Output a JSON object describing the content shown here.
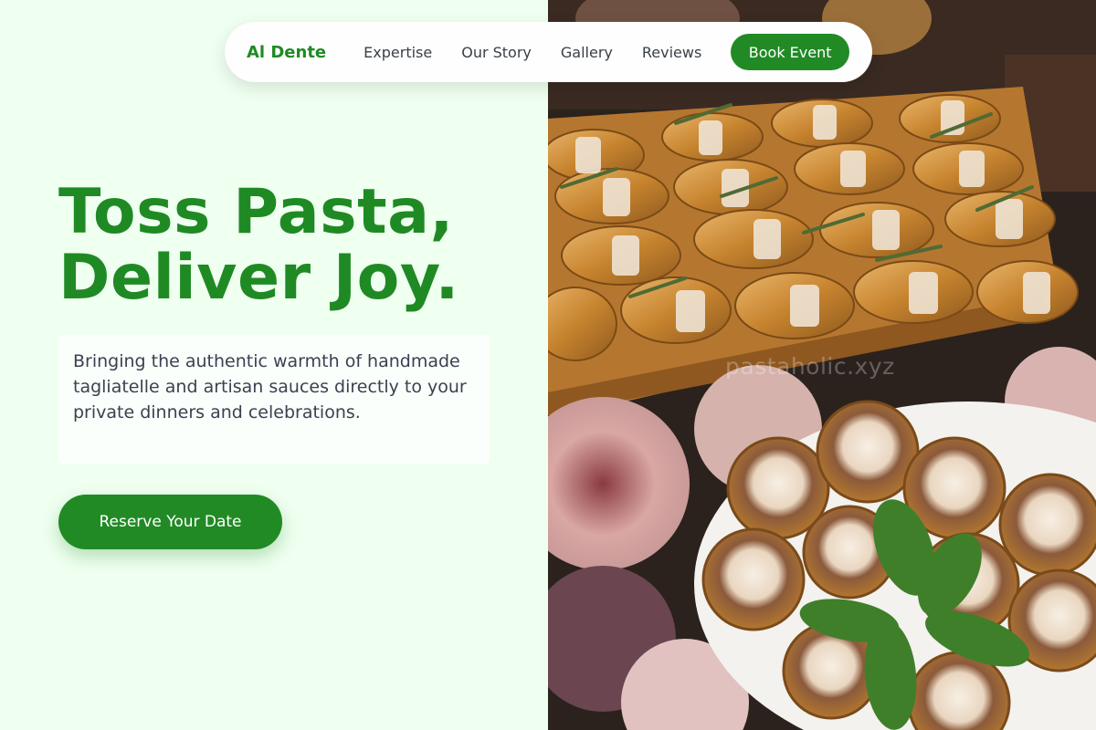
{
  "nav": {
    "brand": "Al Dente",
    "links": [
      "Expertise",
      "Our Story",
      "Gallery",
      "Reviews"
    ],
    "cta_label": "Book Event"
  },
  "hero": {
    "headline_line1": "Toss Pasta,",
    "headline_line2": "Deliver Joy.",
    "description": "Bringing the authentic warmth of handmade tagliatelle and artisan sauces directly to your private dinners and celebrations.",
    "cta_label": "Reserve Your Date"
  },
  "photo": {
    "watermark": "pastaholic.xyz",
    "subject": "catering spread of croissants on wooden board and cream tarts on white plate with flowers"
  },
  "colors": {
    "accent": "#218a25",
    "page_background": "#effff0"
  }
}
